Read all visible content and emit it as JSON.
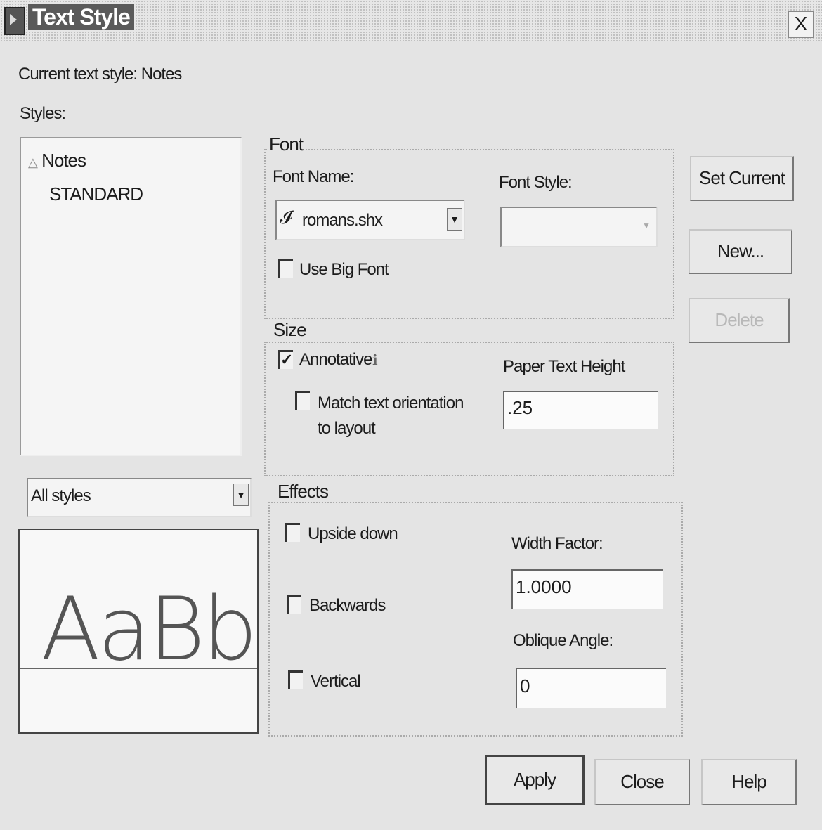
{
  "window": {
    "title": "Text Style",
    "close_label": "X"
  },
  "current_style": {
    "label": "Current text style:",
    "value": "Notes"
  },
  "styles": {
    "label": "Styles:",
    "items": [
      {
        "label": "Notes",
        "icon": "annotative-icon"
      },
      {
        "label": "STANDARD"
      }
    ],
    "filter_value": "All styles"
  },
  "preview": {
    "sample_text": "AaBbCc"
  },
  "font": {
    "group_label": "Font",
    "font_name_label": "Font Name:",
    "font_name_value": "romans.shx",
    "font_style_label": "Font Style:",
    "font_style_value": "",
    "big_font_label": "Use Big Font",
    "big_font_checked": false
  },
  "size": {
    "group_label": "Size",
    "annotative_label": "Annotative",
    "annotative_checked": true,
    "match_orientation_line1": "Match text orientation",
    "match_orientation_line2": "to layout",
    "match_orientation_checked": false,
    "paper_height_label": "Paper Text Height",
    "paper_height_value": ".25"
  },
  "effects": {
    "group_label": "Effects",
    "upside_down_label": "Upside down",
    "backwards_label": "Backwards",
    "vertical_label": "Vertical",
    "width_factor_label": "Width Factor:",
    "width_factor_value": "1.0000",
    "oblique_label": "Oblique Angle:",
    "oblique_value": "0"
  },
  "buttons": {
    "set_current": "Set Current",
    "new": "New...",
    "delete": "Delete",
    "apply": "Apply",
    "close": "Close",
    "help": "Help"
  }
}
